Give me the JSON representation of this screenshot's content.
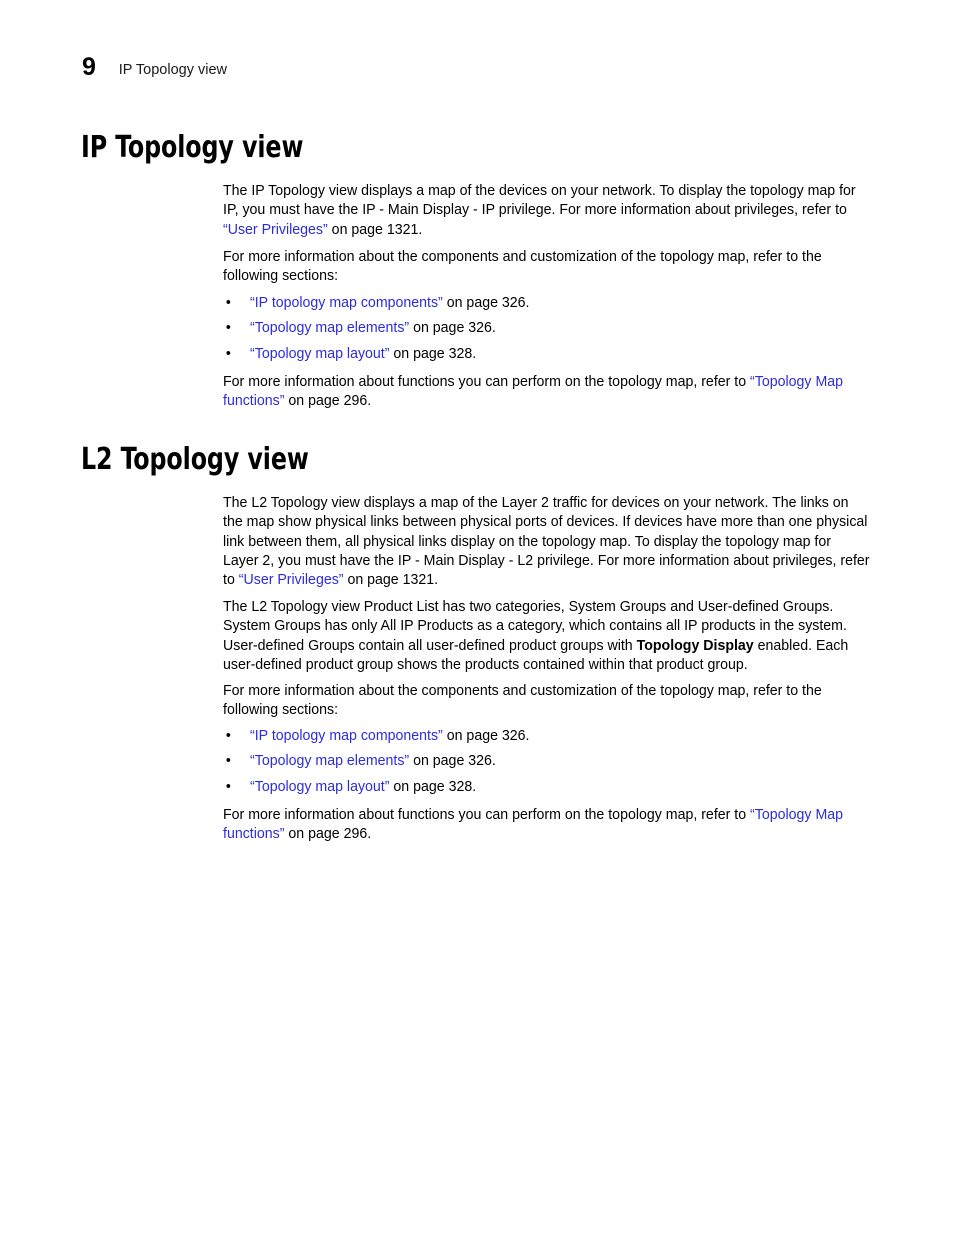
{
  "header": {
    "chapter_number": "9",
    "title": "IP Topology view"
  },
  "sections": [
    {
      "id": "ip-topology-view",
      "heading": "IP Topology view",
      "paragraph_1": {
        "part_1": "The IP Topology view displays a map of the devices on your network. To display the topology map for IP, you must have the IP - Main Display - IP privilege. For more information about privileges, refer to ",
        "link": "“User Privileges”",
        "part_2": " on page 1321."
      },
      "paragraph_2": "For more information about the components and customization of the topology map, refer to the following sections:",
      "bullets": [
        {
          "bullet": "•",
          "link": "“IP topology map components”",
          "tail": " on page 326."
        },
        {
          "bullet": "•",
          "link": "“Topology map elements”",
          "tail": " on page 326."
        },
        {
          "bullet": "•",
          "link": "“Topology map layout”",
          "tail": " on page 328."
        }
      ],
      "paragraph_3": {
        "part_1": "For more information about functions you can perform on the topology map, refer to ",
        "link": "“Topology Map functions”",
        "part_2": " on page 296."
      }
    },
    {
      "id": "l2-topology-view",
      "heading": "L2 Topology view",
      "paragraph_1": {
        "part_1": "The L2 Topology view displays a map of the Layer 2 traffic for devices on your network. The links on the map show physical links between physical ports of devices. If devices have more than one physical link between them, all physical links display on the topology map. To display the topology map for Layer 2, you must have the IP - Main Display - L2 privilege. For more information about privileges, refer to ",
        "link": "“User Privileges”",
        "part_2": " on page 1321."
      },
      "paragraph_2": {
        "part_1": "The L2 Topology view Product List has two categories, System Groups and User-defined Groups. System Groups has only All IP Products as a category, which contains all IP products in the system. User-defined Groups contain all user-defined product groups with ",
        "bold": "Topology Display",
        "part_2": " enabled. Each user-defined product group shows the products contained within that product group."
      },
      "paragraph_3": "For more information about the components and customization of the topology map, refer to the following sections:",
      "bullets": [
        {
          "bullet": "•",
          "link": "“IP topology map components”",
          "tail": " on page 326."
        },
        {
          "bullet": "•",
          "link": "“Topology map elements”",
          "tail": " on page 326."
        },
        {
          "bullet": "•",
          "link": "“Topology map layout”",
          "tail": " on page 328."
        }
      ],
      "paragraph_4": {
        "part_1": "For more information about functions you can perform on the topology map, refer to ",
        "link": "“Topology Map functions”",
        "part_2": " on page 296."
      }
    }
  ],
  "colors": {
    "link": "#2c2cdb",
    "text": "#000000",
    "page_background": "#ffffff"
  }
}
